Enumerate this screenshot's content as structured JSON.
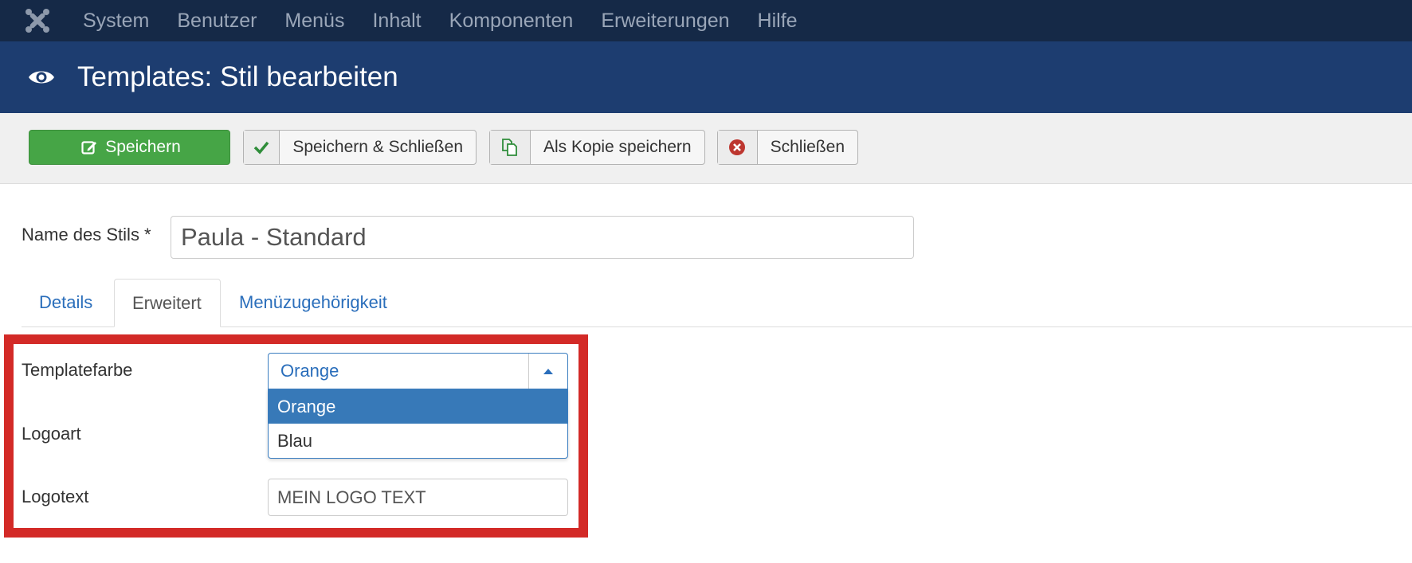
{
  "nav": {
    "menu": [
      "System",
      "Benutzer",
      "Menüs",
      "Inhalt",
      "Komponenten",
      "Erweiterungen",
      "Hilfe"
    ]
  },
  "title": "Templates: Stil bearbeiten",
  "toolbar": {
    "save": "Speichern",
    "save_close": "Speichern & Schließen",
    "save_copy": "Als Kopie speichern",
    "close": "Schließen"
  },
  "form": {
    "style_name_label": "Name des Stils *",
    "style_name_value": "Paula - Standard"
  },
  "tabs": [
    "Details",
    "Erweitert",
    "Menüzugehörigkeit"
  ],
  "advanced": {
    "template_color_label": "Templatefarbe",
    "template_color_value": "Orange",
    "template_color_options": [
      "Orange",
      "Blau"
    ],
    "logo_type_label": "Logoart",
    "logo_text_label": "Logotext",
    "logo_text_value": "MEIN LOGO TEXT"
  },
  "colors": {
    "highlight": "#d32a27",
    "save_button": "#46a546",
    "header": "#1d3d70"
  }
}
